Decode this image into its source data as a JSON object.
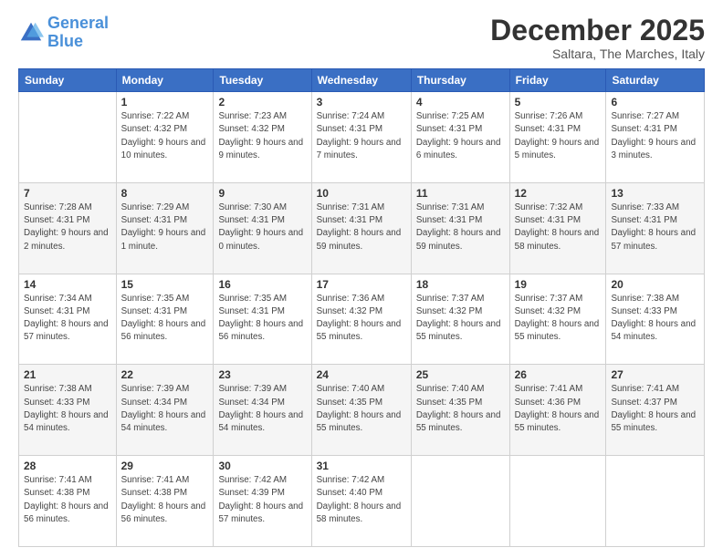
{
  "logo": {
    "text_general": "General",
    "text_blue": "Blue"
  },
  "header": {
    "title": "December 2025",
    "subtitle": "Saltara, The Marches, Italy"
  },
  "weekdays": [
    "Sunday",
    "Monday",
    "Tuesday",
    "Wednesday",
    "Thursday",
    "Friday",
    "Saturday"
  ],
  "weeks": [
    [
      {
        "day": "",
        "sunrise": "",
        "sunset": "",
        "daylight": ""
      },
      {
        "day": "1",
        "sunrise": "Sunrise: 7:22 AM",
        "sunset": "Sunset: 4:32 PM",
        "daylight": "Daylight: 9 hours and 10 minutes."
      },
      {
        "day": "2",
        "sunrise": "Sunrise: 7:23 AM",
        "sunset": "Sunset: 4:32 PM",
        "daylight": "Daylight: 9 hours and 9 minutes."
      },
      {
        "day": "3",
        "sunrise": "Sunrise: 7:24 AM",
        "sunset": "Sunset: 4:31 PM",
        "daylight": "Daylight: 9 hours and 7 minutes."
      },
      {
        "day": "4",
        "sunrise": "Sunrise: 7:25 AM",
        "sunset": "Sunset: 4:31 PM",
        "daylight": "Daylight: 9 hours and 6 minutes."
      },
      {
        "day": "5",
        "sunrise": "Sunrise: 7:26 AM",
        "sunset": "Sunset: 4:31 PM",
        "daylight": "Daylight: 9 hours and 5 minutes."
      },
      {
        "day": "6",
        "sunrise": "Sunrise: 7:27 AM",
        "sunset": "Sunset: 4:31 PM",
        "daylight": "Daylight: 9 hours and 3 minutes."
      }
    ],
    [
      {
        "day": "7",
        "sunrise": "Sunrise: 7:28 AM",
        "sunset": "Sunset: 4:31 PM",
        "daylight": "Daylight: 9 hours and 2 minutes."
      },
      {
        "day": "8",
        "sunrise": "Sunrise: 7:29 AM",
        "sunset": "Sunset: 4:31 PM",
        "daylight": "Daylight: 9 hours and 1 minute."
      },
      {
        "day": "9",
        "sunrise": "Sunrise: 7:30 AM",
        "sunset": "Sunset: 4:31 PM",
        "daylight": "Daylight: 9 hours and 0 minutes."
      },
      {
        "day": "10",
        "sunrise": "Sunrise: 7:31 AM",
        "sunset": "Sunset: 4:31 PM",
        "daylight": "Daylight: 8 hours and 59 minutes."
      },
      {
        "day": "11",
        "sunrise": "Sunrise: 7:31 AM",
        "sunset": "Sunset: 4:31 PM",
        "daylight": "Daylight: 8 hours and 59 minutes."
      },
      {
        "day": "12",
        "sunrise": "Sunrise: 7:32 AM",
        "sunset": "Sunset: 4:31 PM",
        "daylight": "Daylight: 8 hours and 58 minutes."
      },
      {
        "day": "13",
        "sunrise": "Sunrise: 7:33 AM",
        "sunset": "Sunset: 4:31 PM",
        "daylight": "Daylight: 8 hours and 57 minutes."
      }
    ],
    [
      {
        "day": "14",
        "sunrise": "Sunrise: 7:34 AM",
        "sunset": "Sunset: 4:31 PM",
        "daylight": "Daylight: 8 hours and 57 minutes."
      },
      {
        "day": "15",
        "sunrise": "Sunrise: 7:35 AM",
        "sunset": "Sunset: 4:31 PM",
        "daylight": "Daylight: 8 hours and 56 minutes."
      },
      {
        "day": "16",
        "sunrise": "Sunrise: 7:35 AM",
        "sunset": "Sunset: 4:31 PM",
        "daylight": "Daylight: 8 hours and 56 minutes."
      },
      {
        "day": "17",
        "sunrise": "Sunrise: 7:36 AM",
        "sunset": "Sunset: 4:32 PM",
        "daylight": "Daylight: 8 hours and 55 minutes."
      },
      {
        "day": "18",
        "sunrise": "Sunrise: 7:37 AM",
        "sunset": "Sunset: 4:32 PM",
        "daylight": "Daylight: 8 hours and 55 minutes."
      },
      {
        "day": "19",
        "sunrise": "Sunrise: 7:37 AM",
        "sunset": "Sunset: 4:32 PM",
        "daylight": "Daylight: 8 hours and 55 minutes."
      },
      {
        "day": "20",
        "sunrise": "Sunrise: 7:38 AM",
        "sunset": "Sunset: 4:33 PM",
        "daylight": "Daylight: 8 hours and 54 minutes."
      }
    ],
    [
      {
        "day": "21",
        "sunrise": "Sunrise: 7:38 AM",
        "sunset": "Sunset: 4:33 PM",
        "daylight": "Daylight: 8 hours and 54 minutes."
      },
      {
        "day": "22",
        "sunrise": "Sunrise: 7:39 AM",
        "sunset": "Sunset: 4:34 PM",
        "daylight": "Daylight: 8 hours and 54 minutes."
      },
      {
        "day": "23",
        "sunrise": "Sunrise: 7:39 AM",
        "sunset": "Sunset: 4:34 PM",
        "daylight": "Daylight: 8 hours and 54 minutes."
      },
      {
        "day": "24",
        "sunrise": "Sunrise: 7:40 AM",
        "sunset": "Sunset: 4:35 PM",
        "daylight": "Daylight: 8 hours and 55 minutes."
      },
      {
        "day": "25",
        "sunrise": "Sunrise: 7:40 AM",
        "sunset": "Sunset: 4:35 PM",
        "daylight": "Daylight: 8 hours and 55 minutes."
      },
      {
        "day": "26",
        "sunrise": "Sunrise: 7:41 AM",
        "sunset": "Sunset: 4:36 PM",
        "daylight": "Daylight: 8 hours and 55 minutes."
      },
      {
        "day": "27",
        "sunrise": "Sunrise: 7:41 AM",
        "sunset": "Sunset: 4:37 PM",
        "daylight": "Daylight: 8 hours and 55 minutes."
      }
    ],
    [
      {
        "day": "28",
        "sunrise": "Sunrise: 7:41 AM",
        "sunset": "Sunset: 4:38 PM",
        "daylight": "Daylight: 8 hours and 56 minutes."
      },
      {
        "day": "29",
        "sunrise": "Sunrise: 7:41 AM",
        "sunset": "Sunset: 4:38 PM",
        "daylight": "Daylight: 8 hours and 56 minutes."
      },
      {
        "day": "30",
        "sunrise": "Sunrise: 7:42 AM",
        "sunset": "Sunset: 4:39 PM",
        "daylight": "Daylight: 8 hours and 57 minutes."
      },
      {
        "day": "31",
        "sunrise": "Sunrise: 7:42 AM",
        "sunset": "Sunset: 4:40 PM",
        "daylight": "Daylight: 8 hours and 58 minutes."
      },
      {
        "day": "",
        "sunrise": "",
        "sunset": "",
        "daylight": ""
      },
      {
        "day": "",
        "sunrise": "",
        "sunset": "",
        "daylight": ""
      },
      {
        "day": "",
        "sunrise": "",
        "sunset": "",
        "daylight": ""
      }
    ]
  ]
}
